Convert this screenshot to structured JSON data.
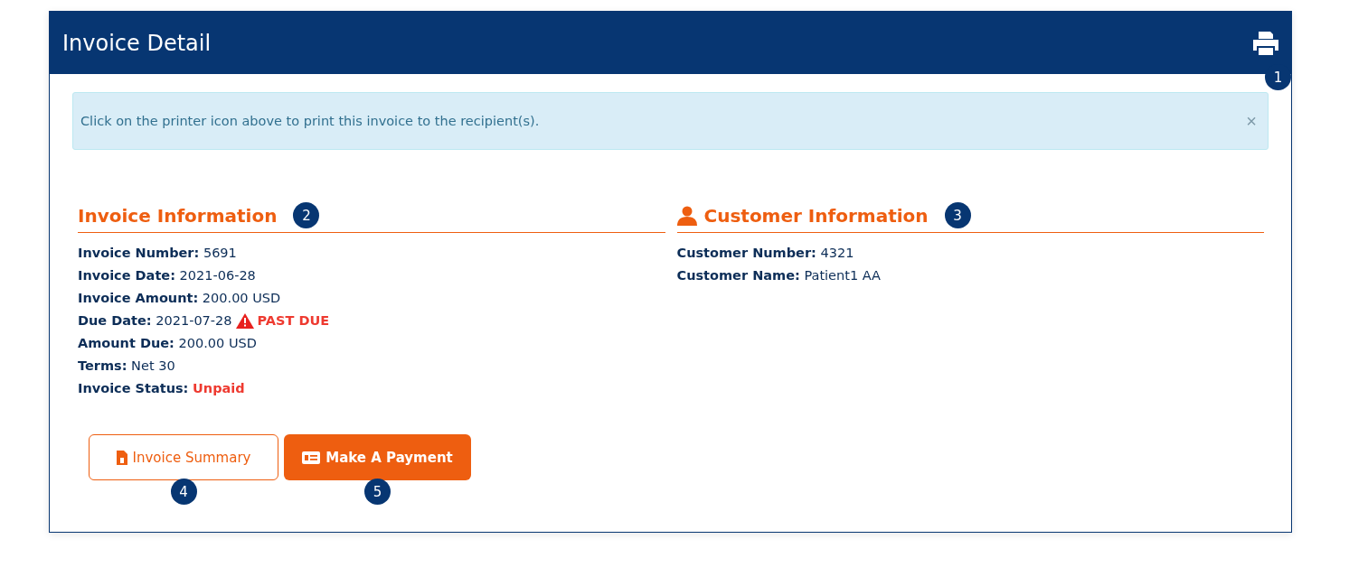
{
  "header": {
    "title": "Invoice Detail",
    "callout": "1"
  },
  "alert": {
    "message": "Click on the printer icon above to print this invoice to the recipient(s).",
    "close": "×"
  },
  "sections": [
    {
      "title": "Invoice Information",
      "kind": "invoice",
      "callout": "2",
      "fields": [
        {
          "label": "Invoice Number:",
          "value": "5691",
          "kind": "plain"
        },
        {
          "label": "Invoice Date:",
          "value": "2021-06-28",
          "kind": "plain"
        },
        {
          "label": "Invoice Amount:",
          "value": "200.00 USD",
          "kind": "plain"
        },
        {
          "label": "Due Date:",
          "value": "2021-07-28",
          "kind": "warning",
          "warning": "PAST DUE"
        },
        {
          "label": "Amount Due:",
          "value": "200.00 USD",
          "kind": "plain"
        },
        {
          "label": "Terms:",
          "value": "Net 30",
          "kind": "plain"
        },
        {
          "label": "Invoice Status:",
          "value": "Unpaid",
          "kind": "danger"
        }
      ]
    },
    {
      "title": "Customer Information",
      "kind": "customer",
      "callout": "3",
      "fields": [
        {
          "label": "Customer Number:",
          "value": "4321",
          "kind": "plain"
        },
        {
          "label": "Customer Name:",
          "value": "Patient1 AA",
          "kind": "plain"
        }
      ]
    }
  ],
  "buttons": [
    {
      "label": "Invoice Summary",
      "kind": "outline",
      "callout": "4"
    },
    {
      "label": "Make A Payment",
      "kind": "solid",
      "callout": "5"
    }
  ]
}
